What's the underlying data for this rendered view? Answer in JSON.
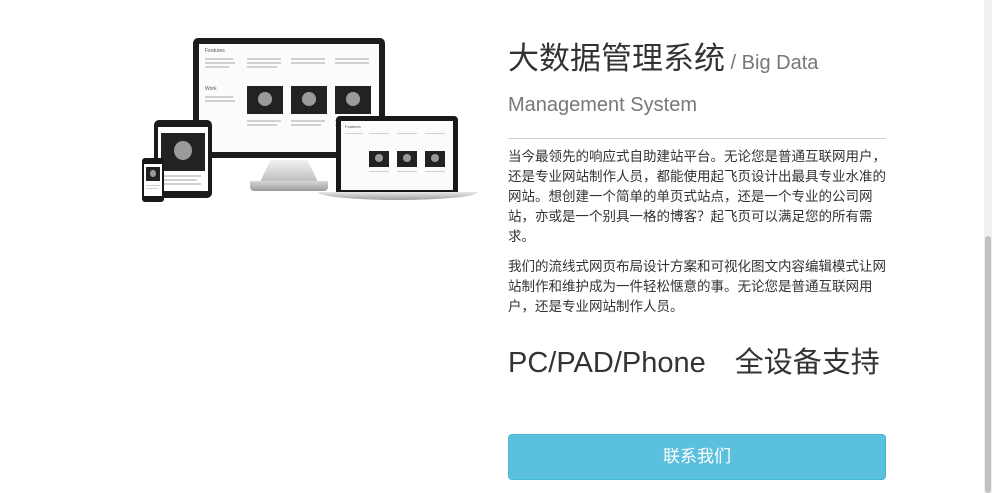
{
  "hero": {
    "title": "大数据管理系统",
    "subtitle": " / Big Data Management System",
    "paragraphs": [
      "当今最领先的响应式自助建站平台。无论您是普通互联网用户，还是专业网站制作人员，都能使用起飞页设计出最具专业水准的网站。想创建一个简单的单页式站点，还是一个专业的公司网站，亦或是一个别具一格的博客？起飞页可以满足您的所有需求。",
      "我们的流线式网页布局设计方案和可视化图文内容编辑模式让网站制作和维护成为一件轻松惬意的事。无论您是普通互联网用户，还是专业网站制作人员。"
    ]
  },
  "devices_section": {
    "title": "PC/PAD/Phone　全设备支持"
  },
  "contact_button": {
    "label": "联系我们"
  },
  "mock_screen": {
    "monitor_heading": "Features",
    "monitor_heading_2": "Work",
    "laptop_heading": "Features"
  },
  "colors": {
    "button_bg": "#5bc0de",
    "button_border": "#46b8da",
    "text": "#333333",
    "subtitle": "#777777"
  }
}
